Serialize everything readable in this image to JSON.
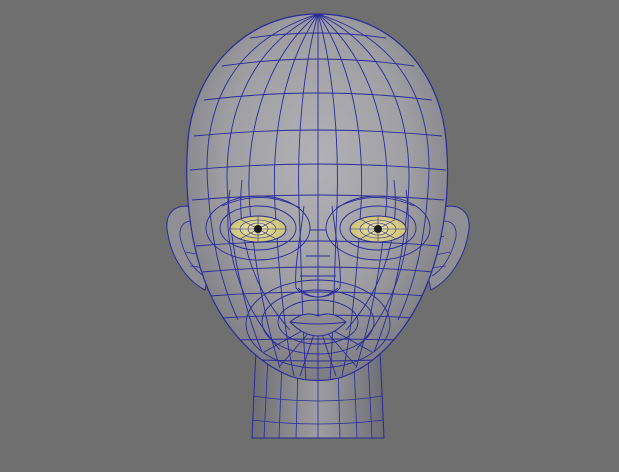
{
  "viewport": {
    "background": "#6f6f6f",
    "shading": "#9a9a9e",
    "wire_color": "#2a2a9a",
    "eye_color": "#e0d890",
    "subject": "head-wireframe"
  }
}
